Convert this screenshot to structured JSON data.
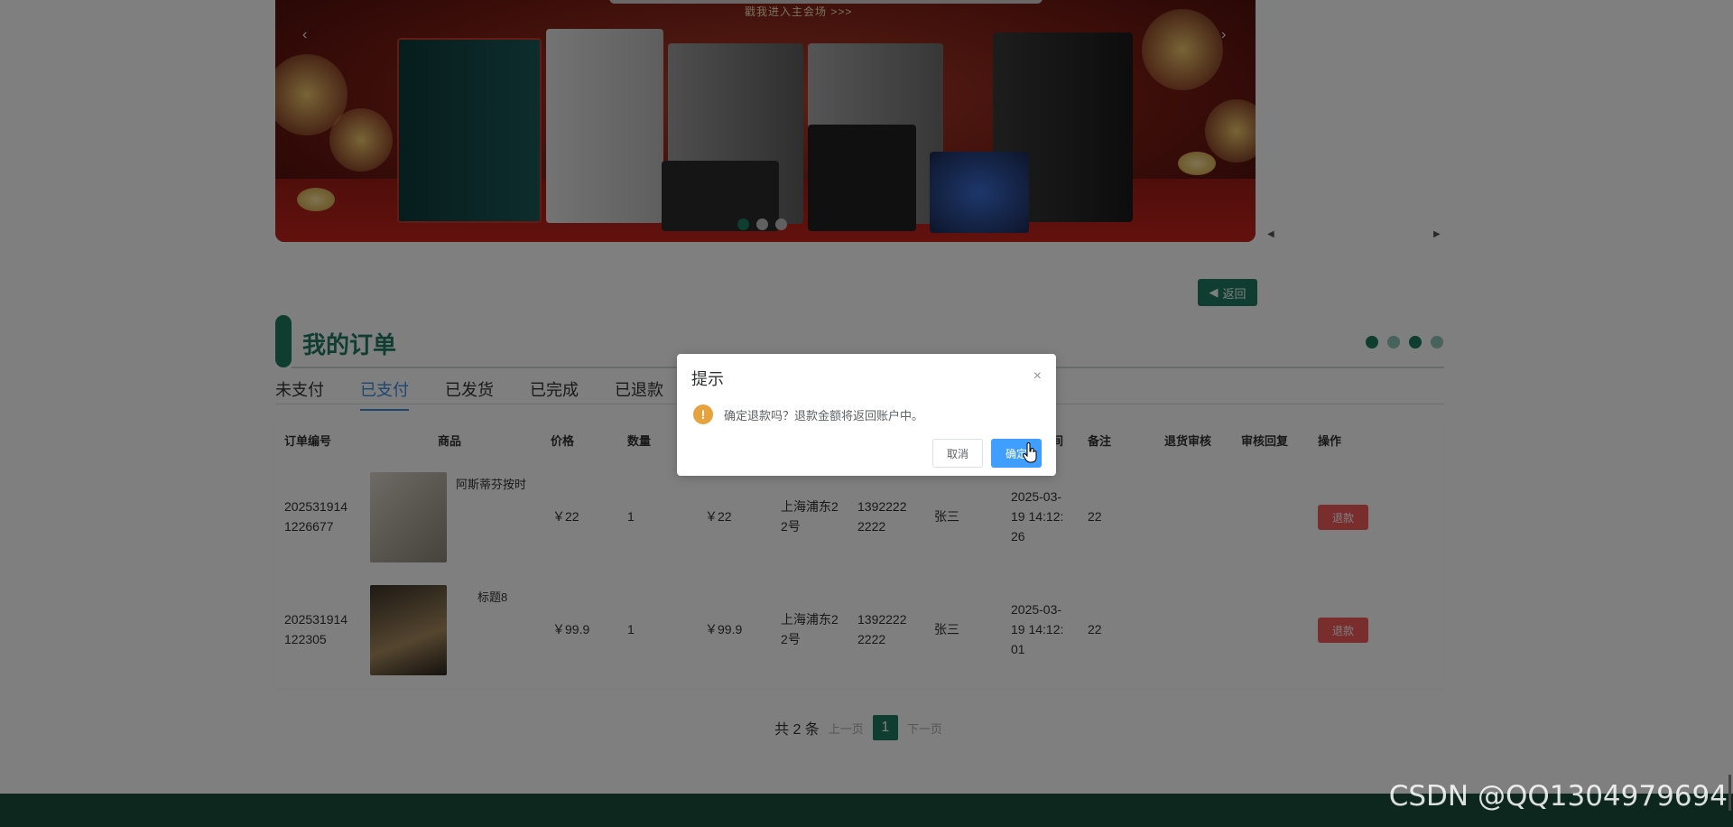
{
  "banner": {
    "top_text": "戳我进入主会场 >>>",
    "prev_arrow": "‹",
    "next_arrow": "›",
    "slide_count": 3,
    "active_slide": 1
  },
  "carousel_side": {
    "prev": "◀",
    "next": "▶"
  },
  "back_button": {
    "label": "返回",
    "icon": "caret-left-icon"
  },
  "section": {
    "title": "我的订单"
  },
  "indicator_dots": [
    "#1f7c62",
    "#8fc6b8",
    "#1f7c62",
    "#8fc6b8"
  ],
  "tabs": [
    {
      "label": "未支付",
      "active": false
    },
    {
      "label": "已支付",
      "active": true
    },
    {
      "label": "已发货",
      "active": false
    },
    {
      "label": "已完成",
      "active": false
    },
    {
      "label": "已退款",
      "active": false
    }
  ],
  "table": {
    "headers": {
      "order_no": "订单编号",
      "product": "商品",
      "price": "价格",
      "qty": "数量",
      "time_tail": "间",
      "remark": "备注",
      "return_review": "退货审核",
      "review_reply": "审核回复",
      "actions": "操作"
    },
    "rows": [
      {
        "order_no": "202531914 1226677",
        "order_no_1": "202531914",
        "order_no_2": "1226677",
        "product_name": "阿斯蒂芬按时",
        "price": "￥22",
        "qty": "1",
        "total": "￥22",
        "address_1": "上海浦东2",
        "address_2": "2号",
        "phone_1": "1392222",
        "phone_2": "2222",
        "name": "张三",
        "time_1": "2025-03-",
        "time_2": "19 14:12:",
        "time_3": "26",
        "remark": "22",
        "refund_label": "退款"
      },
      {
        "order_no": "202531914 122305",
        "order_no_1": "202531914",
        "order_no_2": "122305",
        "product_name": "标题8",
        "price": "￥99.9",
        "qty": "1",
        "total": "￥99.9",
        "address_1": "上海浦东2",
        "address_2": "2号",
        "phone_1": "1392222",
        "phone_2": "2222",
        "name": "张三",
        "time_1": "2025-03-",
        "time_2": "19 14:12:",
        "time_3": "01",
        "remark": "22",
        "refund_label": "退款"
      }
    ]
  },
  "pagination": {
    "total": "共 2 条",
    "prev": "上一页",
    "current": "1",
    "next": "下一页"
  },
  "dialog": {
    "title": "提示",
    "close": "×",
    "icon": "!",
    "message": "确定退款吗？退款金额将返回账户中。",
    "cancel": "取消",
    "confirm": "确定"
  },
  "watermark": "CSDN @QQ1304979694",
  "colors": {
    "brand": "#1f7c62",
    "danger": "#f45a5a",
    "primary": "#409eff",
    "warning": "#e6a23c",
    "footer": "#1a4d3c"
  }
}
